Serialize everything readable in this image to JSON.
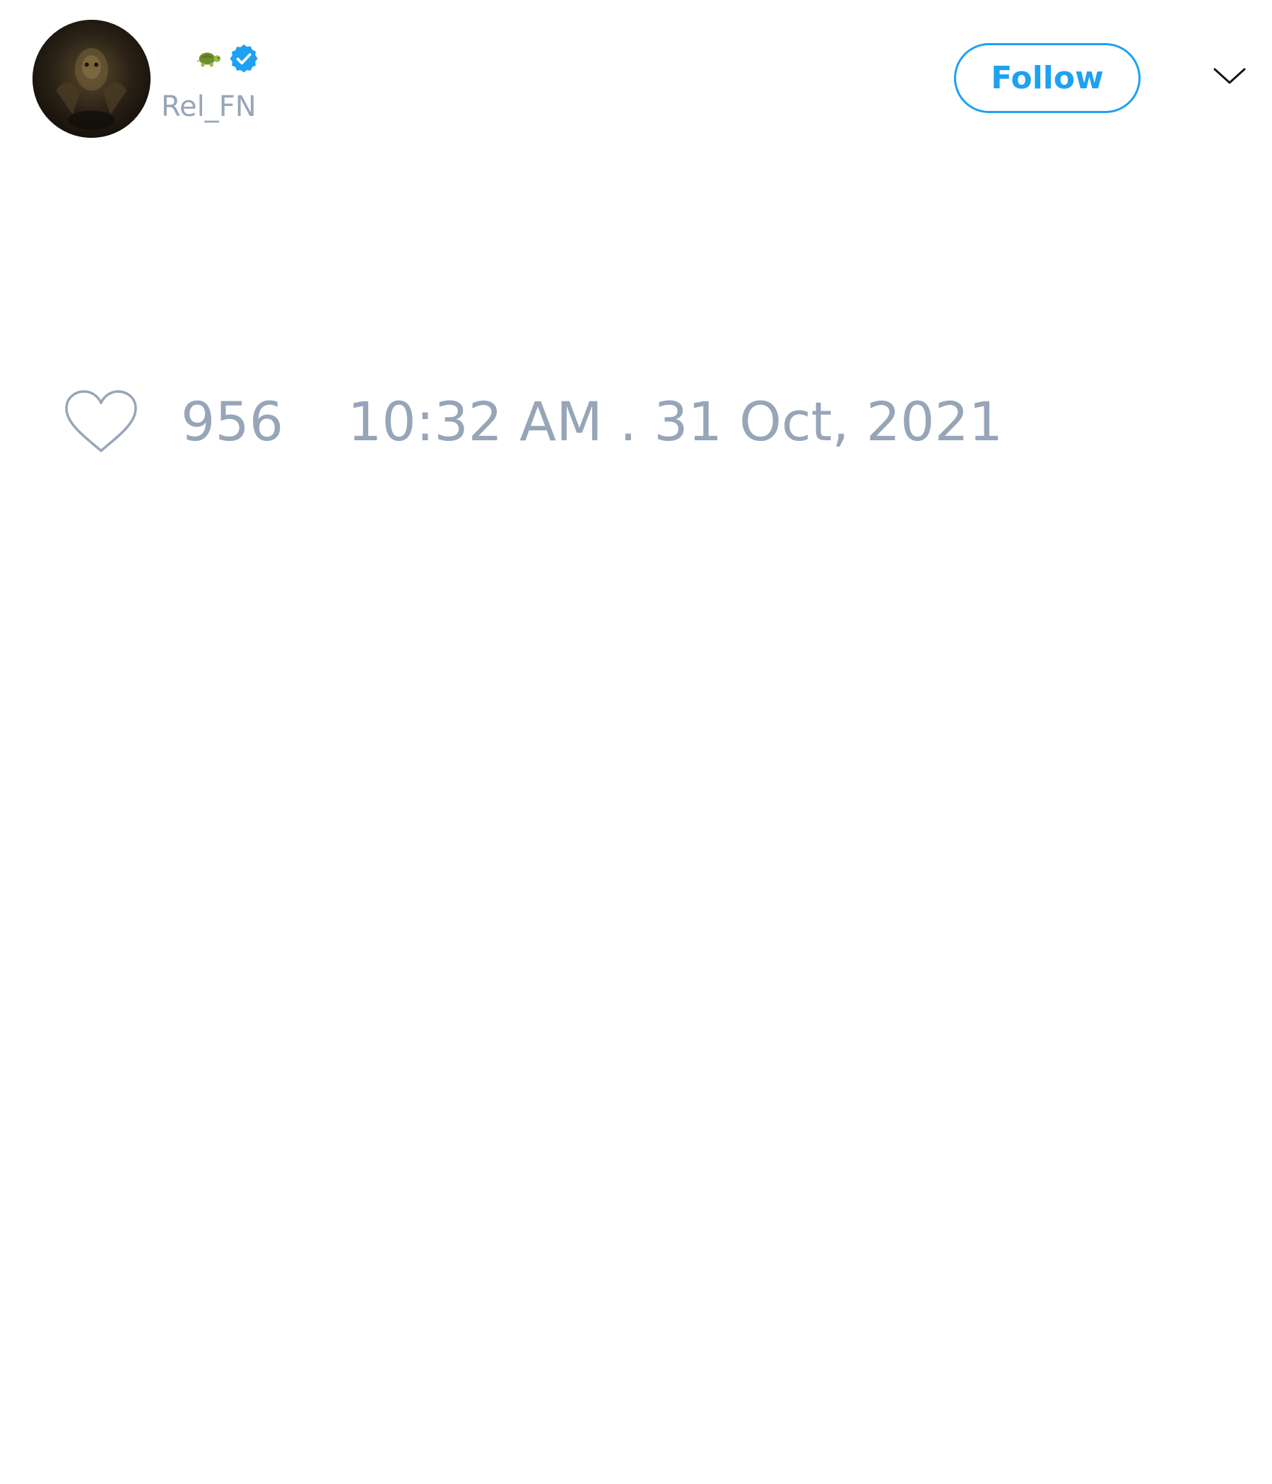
{
  "header": {
    "display_name_emoji": "🐢",
    "verified_icon": "verified-badge-icon",
    "handle": "Rel_FN",
    "follow_label": "Follow",
    "menu_icon": "chevron-down-icon"
  },
  "footer": {
    "like_icon": "heart-icon",
    "like_count": "956",
    "timestamp": "10:32 AM . 31 Oct, 2021"
  },
  "colors": {
    "accent": "#1da1f2",
    "muted_text": "#97a5b8",
    "background": "#ffffff"
  }
}
